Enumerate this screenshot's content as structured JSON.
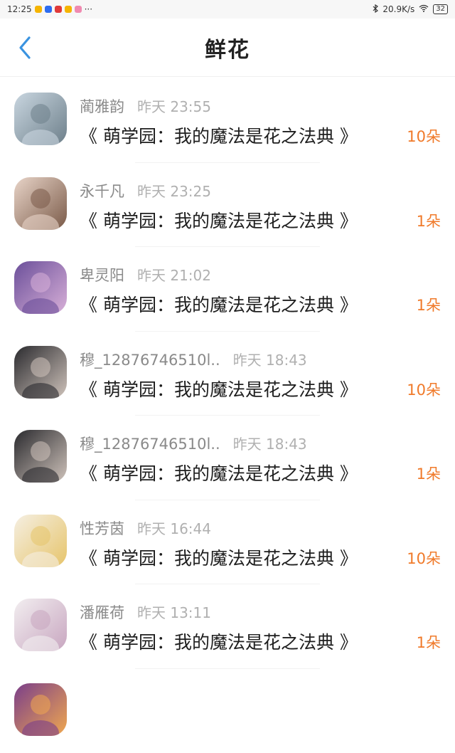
{
  "status_bar": {
    "time": "12:25",
    "more": "···",
    "net_speed": "20.9K/s",
    "battery": "32"
  },
  "header": {
    "title": "鲜花"
  },
  "items": [
    {
      "name": "蔺雅韵",
      "time": "昨天 23:55",
      "book": "《 萌学园：我的魔法是花之法典 》",
      "count": "10朵",
      "avatar": "avatar-couple",
      "colors": [
        "#c9d6e0",
        "#6d7f8a"
      ]
    },
    {
      "name": "永千凡",
      "time": "昨天 23:25",
      "book": "《 萌学园：我的魔法是花之法典 》",
      "count": "1朵",
      "avatar": "avatar-girl",
      "colors": [
        "#e8d4c8",
        "#7a5a48"
      ]
    },
    {
      "name": "卑灵阳",
      "time": "昨天 21:02",
      "book": "《 萌学园：我的魔法是花之法典 》",
      "count": "1朵",
      "avatar": "avatar-anime-purple",
      "colors": [
        "#6b4f9a",
        "#d8b0d8"
      ]
    },
    {
      "name": "穆_12876746510l..",
      "time": "昨天 18:43",
      "book": "《 萌学园：我的魔法是花之法典 》",
      "count": "10朵",
      "avatar": "avatar-boy",
      "colors": [
        "#2a2a2e",
        "#cfc3bb"
      ]
    },
    {
      "name": "穆_12876746510l..",
      "time": "昨天 18:43",
      "book": "《 萌学园：我的魔法是花之法典 》",
      "count": "1朵",
      "avatar": "avatar-boy",
      "colors": [
        "#2a2a2e",
        "#cfc3bb"
      ]
    },
    {
      "name": "性芳茵",
      "time": "昨天 16:44",
      "book": "《 萌学园：我的魔法是花之法典 》",
      "count": "10朵",
      "avatar": "avatar-cat",
      "colors": [
        "#f5efe2",
        "#e6c46a"
      ]
    },
    {
      "name": "潘雁荷",
      "time": "昨天 13:11",
      "book": "《 萌学园：我的魔法是花之法典 》",
      "count": "1朵",
      "avatar": "avatar-sketch",
      "colors": [
        "#f2eef0",
        "#c8a6c0"
      ]
    },
    {
      "name": "",
      "time": "",
      "book": "",
      "count": "",
      "avatar": "avatar-partial",
      "colors": [
        "#7a3e8a",
        "#f0a850"
      ]
    }
  ]
}
